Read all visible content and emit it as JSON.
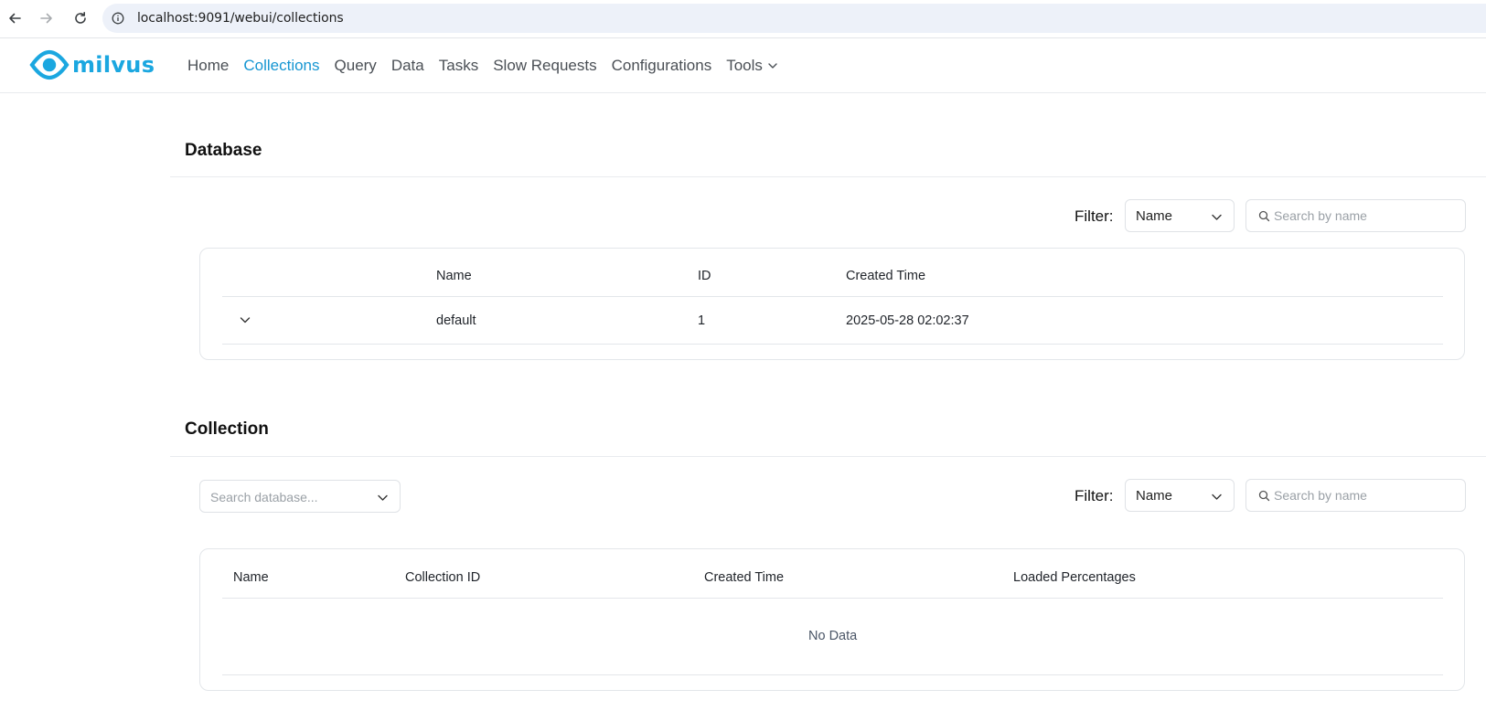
{
  "browser": {
    "url": "localhost:9091/webui/collections"
  },
  "app": {
    "brand": "milvus",
    "brand_color": "#1ba7e0",
    "nav": {
      "home": "Home",
      "collections": "Collections",
      "query": "Query",
      "data": "Data",
      "tasks": "Tasks",
      "slow_requests": "Slow Requests",
      "configurations": "Configurations",
      "tools": "Tools"
    },
    "active_nav": "collections"
  },
  "database_section": {
    "title": "Database",
    "filter_label": "Filter:",
    "filter_value": "Name",
    "search_placeholder": "Search by name",
    "columns": {
      "name": "Name",
      "id": "ID",
      "created_time": "Created Time"
    },
    "rows": [
      {
        "name": "default",
        "id": "1",
        "created_time": "2025-05-28 02:02:37"
      }
    ]
  },
  "collection_section": {
    "title": "Collection",
    "database_placeholder": "Search database...",
    "filter_label": "Filter:",
    "filter_value": "Name",
    "search_placeholder": "Search by name",
    "columns": {
      "name": "Name",
      "collection_id": "Collection ID",
      "created_time": "Created Time",
      "loaded_percentages": "Loaded Percentages"
    },
    "empty_text": "No Data"
  }
}
